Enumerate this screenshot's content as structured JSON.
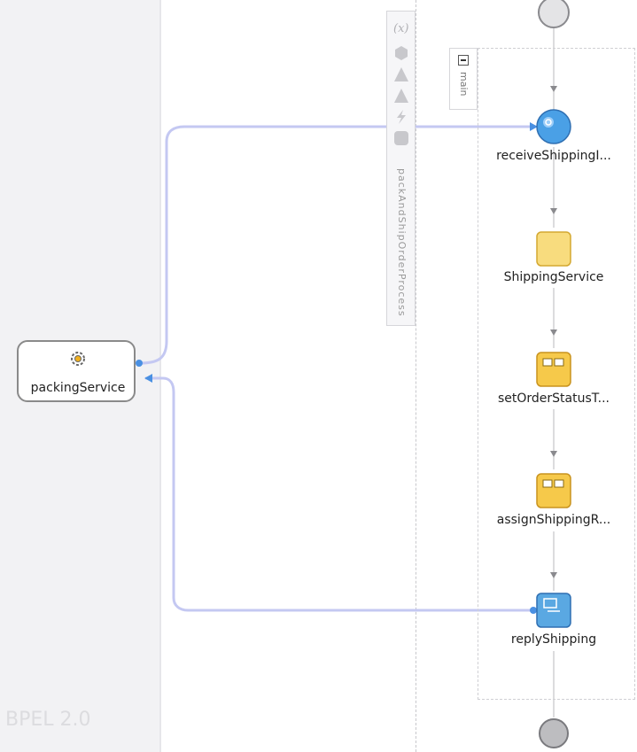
{
  "partner_lane": {
    "version_label": "BPEL 2.0",
    "partner": {
      "name": "packingService",
      "icon": "gear-icon"
    }
  },
  "process": {
    "name": "packAndShipOrderProcess",
    "toolbar_icons": [
      "variables-icon",
      "correlation-icon",
      "warning-icon",
      "warning-icon",
      "event-icon",
      "compensation-icon"
    ],
    "toolbar_var_glyph": "(x)",
    "scope": {
      "name": "main",
      "activities": [
        {
          "id": "receive",
          "label": "receiveShippingI...",
          "icon": "receive-icon"
        },
        {
          "id": "invoke",
          "label": "ShippingService",
          "icon": "invoke-icon"
        },
        {
          "id": "assign1",
          "label": "setOrderStatusT...",
          "icon": "assign-icon"
        },
        {
          "id": "assign2",
          "label": "assignShippingR...",
          "icon": "assign-icon"
        },
        {
          "id": "reply",
          "label": "replyShipping",
          "icon": "reply-icon"
        }
      ]
    }
  },
  "colors": {
    "wire": "#c4c8f2",
    "receive": "#4aa0e6",
    "assign": "#f6c94a",
    "invoke": "#f8dc7e",
    "reply": "#5aa8e2"
  }
}
